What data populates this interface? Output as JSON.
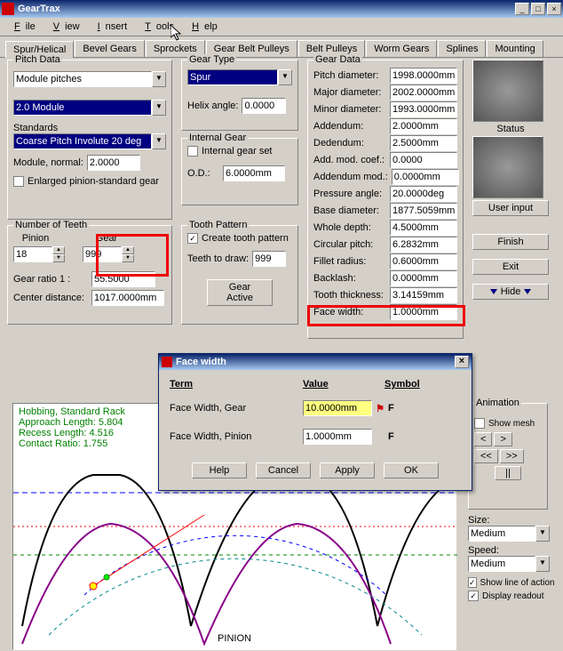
{
  "app": {
    "title": "GearTrax"
  },
  "menu": {
    "file": "File",
    "view": "View",
    "insert": "Insert",
    "tools": "Tools",
    "help": "Help"
  },
  "tabs": [
    "Spur/Helical",
    "Bevel Gears",
    "Sprockets",
    "Gear Belt Pulleys",
    "Belt Pulleys",
    "Worm Gears",
    "Splines",
    "Mounting"
  ],
  "pitch": {
    "legend": "Pitch Data",
    "system": "Module pitches",
    "module": "2.0 Module",
    "standards_label": "Standards",
    "standard": "Coarse Pitch Involute 20 deg",
    "module_normal_label": "Module, normal:",
    "module_normal": "2.0000",
    "enlarged": "Enlarged pinion-standard gear"
  },
  "teeth": {
    "legend": "Number of Teeth",
    "pinion_label": "Pinion",
    "pinion": "18",
    "gear_label": "Gear",
    "gear": "999",
    "ratio_label": "Gear ratio 1 :",
    "ratio": "55.5000",
    "center_label": "Center distance:",
    "center": "1017.0000mm"
  },
  "geartype": {
    "legend": "Gear Type",
    "type": "Spur",
    "helix_label": "Helix angle:",
    "helix": "0.0000"
  },
  "internal": {
    "legend": "Internal Gear",
    "set": "Internal gear set",
    "od_label": "O.D.:",
    "od": "6.0000mm"
  },
  "tooth": {
    "legend": "Tooth Pattern",
    "create": "Create tooth pattern",
    "draw_label": "Teeth to draw:",
    "draw": "999",
    "active": "Gear Active"
  },
  "geardata": {
    "legend": "Gear Data",
    "rows": [
      {
        "l": "Pitch diameter:",
        "v": "1998.0000mm"
      },
      {
        "l": "Major diameter:",
        "v": "2002.0000mm"
      },
      {
        "l": "Minor diameter:",
        "v": "1993.0000mm"
      },
      {
        "l": "Addendum:",
        "v": "2.0000mm"
      },
      {
        "l": "Dedendum:",
        "v": "2.5000mm"
      },
      {
        "l": "Add. mod. coef.:",
        "v": "0.0000"
      },
      {
        "l": "Addendum mod.:",
        "v": "0.0000mm"
      },
      {
        "l": "Pressure angle:",
        "v": "20.0000deg"
      },
      {
        "l": "Base diameter:",
        "v": "1877.5059mm"
      },
      {
        "l": "Whole depth:",
        "v": "4.5000mm"
      },
      {
        "l": "Circular pitch:",
        "v": "6.2832mm"
      },
      {
        "l": "Fillet radius:",
        "v": "0.6000mm"
      },
      {
        "l": "Backlash:",
        "v": "0.0000mm"
      },
      {
        "l": "Tooth thickness:",
        "v": "3.14159mm"
      },
      {
        "l": "Face width:",
        "v": "1.0000mm"
      }
    ]
  },
  "status": {
    "label": "Status",
    "text": "User input"
  },
  "buttons": {
    "finish": "Finish",
    "exit": "Exit",
    "hide": "Hide"
  },
  "plot": {
    "l1": "Hobbing, Standard Rack",
    "l2": "Approach Length: 5.804",
    "l3": "Recess Length: 4.516",
    "l4": "Contact Ratio: 1.755",
    "pinion": "PINION"
  },
  "side": {
    "animation": "Animation",
    "show_mesh": "Show mesh",
    "pause": "||",
    "size": "Size:",
    "size_val": "Medium",
    "speed": "Speed:",
    "speed_val": "Medium",
    "show_line": "Show line of action",
    "display": "Display readout"
  },
  "dialog": {
    "title": "Face width",
    "term": "Term",
    "value": "Value",
    "symbol": "Symbol",
    "r1": "Face Width, Gear",
    "v1": "10.0000mm",
    "s1": "F",
    "r2": "Face Width, Pinion",
    "v2": "1.0000mm",
    "s2": "F",
    "help": "Help",
    "cancel": "Cancel",
    "apply": "Apply",
    "ok": "OK"
  }
}
